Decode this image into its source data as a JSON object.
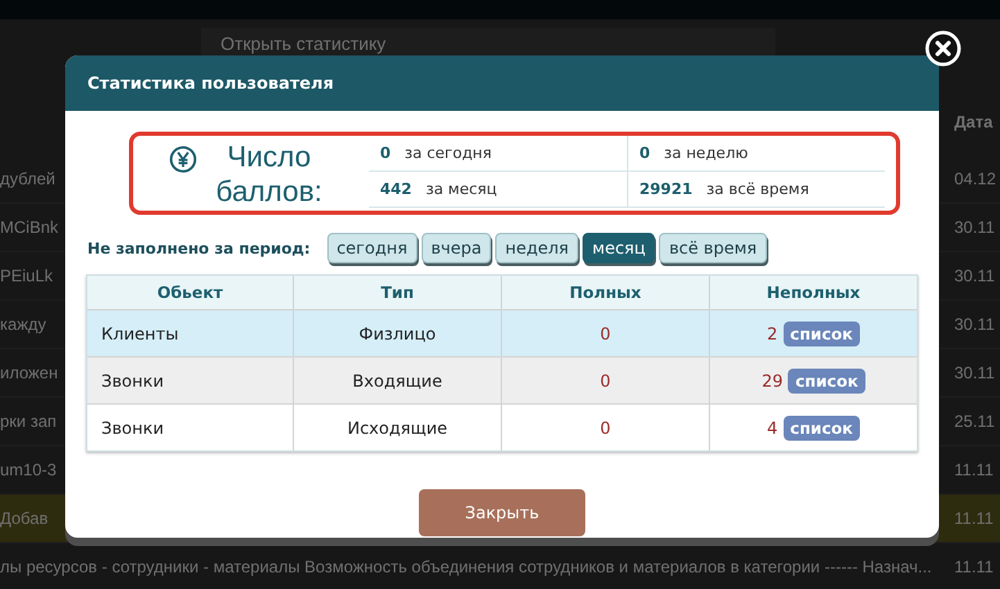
{
  "background": {
    "toolbar_button": "Открыть статистику",
    "date_header": "Дата",
    "rows": [
      {
        "fragment": "дублей",
        "date": "04.12",
        "highlighted": false
      },
      {
        "fragment": "MCiBnk",
        "date": "30.11",
        "highlighted": false
      },
      {
        "fragment": "PEiuLk",
        "date": "30.11",
        "highlighted": false
      },
      {
        "fragment": "кажду",
        "date": "30.11",
        "highlighted": false
      },
      {
        "fragment": "иложен",
        "date": "30.11",
        "highlighted": false
      },
      {
        "fragment": "рки зап",
        "date": "25.11",
        "highlighted": false
      },
      {
        "fragment": "um10-3",
        "date": "11.11",
        "highlighted": false
      },
      {
        "fragment": "Добав",
        "date": "11.11",
        "highlighted": true
      }
    ],
    "footer_text": "лы ресурсов - сотрудники - материалы Возможность объединения сотрудников и материалов в категории ------ Назнач...",
    "footer_date": "11.11"
  },
  "modal": {
    "title": "Статистика пользователя",
    "points": {
      "label": "Число баллов:",
      "stats": [
        {
          "value": "0",
          "label": "за сегодня"
        },
        {
          "value": "0",
          "label": "за неделю"
        },
        {
          "value": "442",
          "label": "за месяц"
        },
        {
          "value": "29921",
          "label": "за всё время"
        }
      ]
    },
    "filter": {
      "label": "Не заполнено за период:",
      "periods": [
        {
          "label": "сегодня",
          "selected": false
        },
        {
          "label": "вчера",
          "selected": false
        },
        {
          "label": "неделя",
          "selected": false
        },
        {
          "label": "месяц",
          "selected": true
        },
        {
          "label": "всё время",
          "selected": false
        }
      ]
    },
    "table": {
      "columns": [
        "Обьект",
        "Тип",
        "Полных",
        "Неполных"
      ],
      "rows": [
        {
          "object": "Клиенты",
          "type": "Физлицо",
          "full": "0",
          "incomplete": "2",
          "button": "список",
          "highlighted": true
        },
        {
          "object": "Звонки",
          "type": "Входящие",
          "full": "0",
          "incomplete": "29",
          "button": "список",
          "highlighted": false
        },
        {
          "object": "Звонки",
          "type": "Исходящие",
          "full": "0",
          "incomplete": "4",
          "button": "список",
          "highlighted": false
        }
      ]
    },
    "close_button": "Закрыть"
  }
}
